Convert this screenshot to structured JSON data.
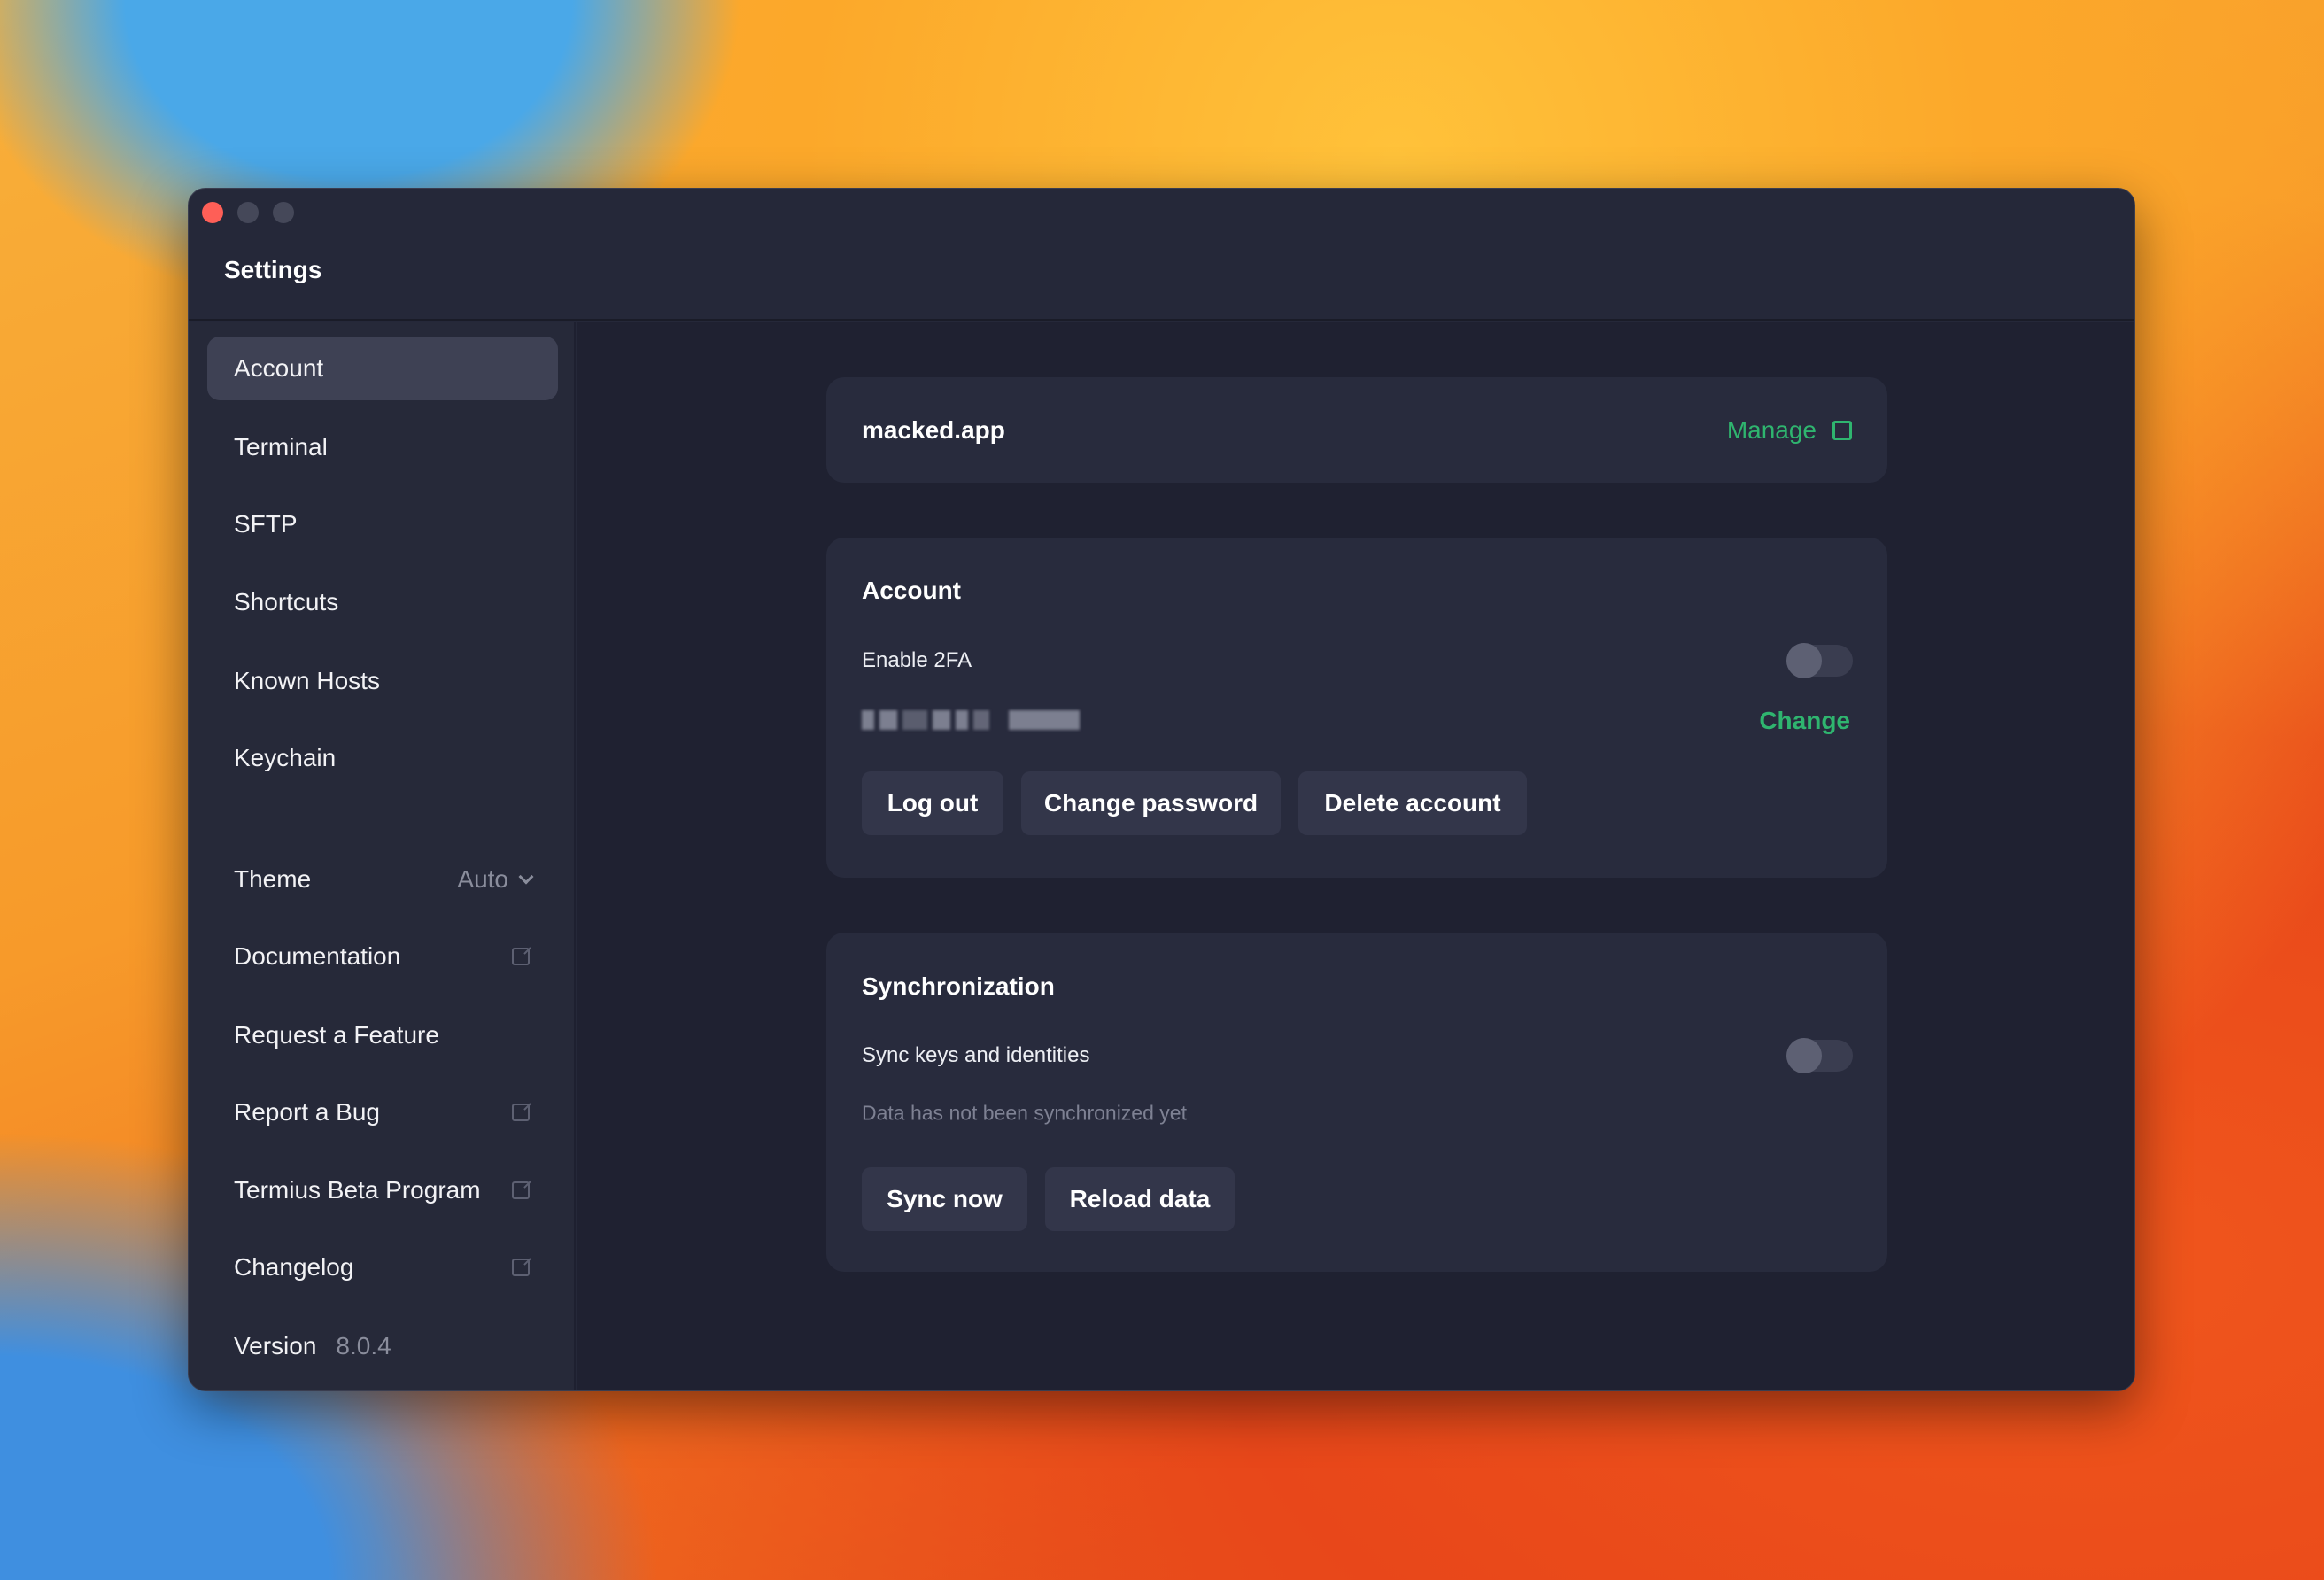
{
  "window": {
    "title": "Settings"
  },
  "sidebar": {
    "items": [
      {
        "label": "Account",
        "selected": true
      },
      {
        "label": "Terminal"
      },
      {
        "label": "SFTP"
      },
      {
        "label": "Shortcuts"
      },
      {
        "label": "Known Hosts"
      },
      {
        "label": "Keychain"
      }
    ],
    "theme": {
      "label": "Theme",
      "value": "Auto"
    },
    "links": [
      {
        "label": "Documentation"
      },
      {
        "label": "Request a Feature"
      },
      {
        "label": "Report a Bug"
      },
      {
        "label": "Termius Beta Program"
      },
      {
        "label": "Changelog"
      }
    ],
    "version": {
      "label": "Version",
      "value": "8.0.4"
    }
  },
  "team": {
    "name": "macked.app",
    "manage": "Manage"
  },
  "account": {
    "heading": "Account",
    "enable_2fa": "Enable 2FA",
    "enable_2fa_on": false,
    "change": "Change",
    "buttons": {
      "logout": "Log out",
      "change_password": "Change password",
      "delete": "Delete account"
    }
  },
  "sync": {
    "heading": "Synchronization",
    "label": "Sync keys and identities",
    "enabled": false,
    "status": "Data has not been synchronized yet",
    "buttons": {
      "sync_now": "Sync now",
      "reload": "Reload data"
    }
  },
  "colors": {
    "accent": "#2fb56f",
    "close": "#fe5f57"
  }
}
